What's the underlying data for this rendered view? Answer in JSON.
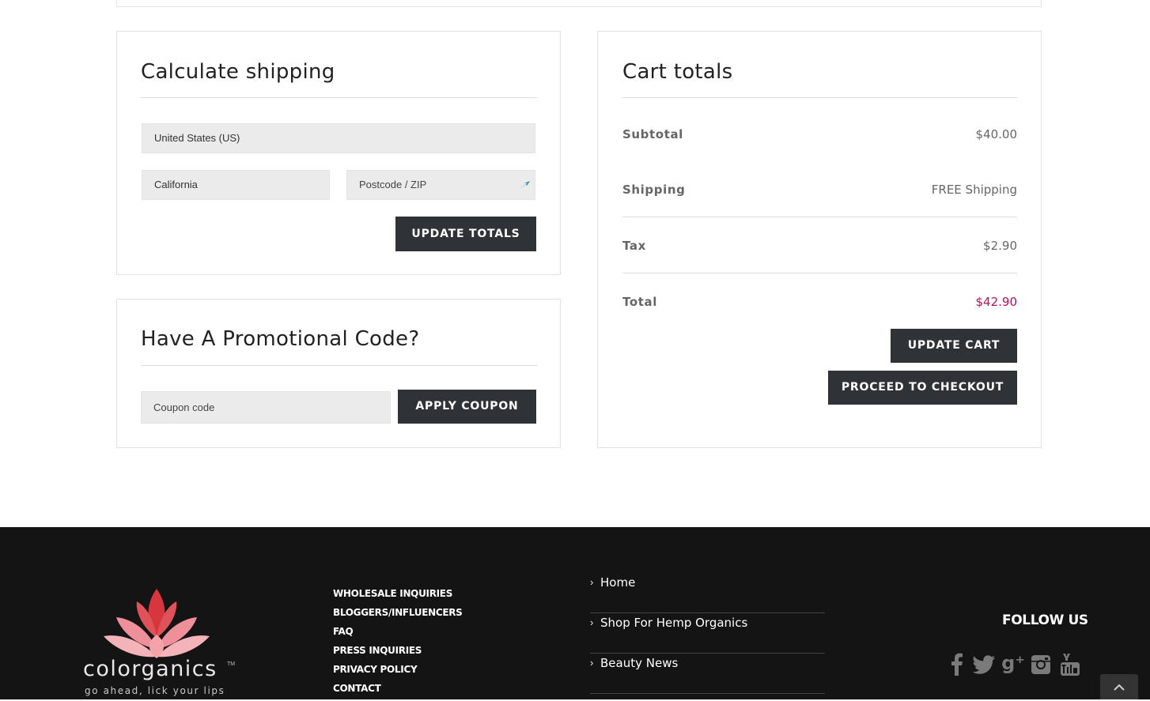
{
  "shipping": {
    "title": "Calculate shipping",
    "country": "United States (US)",
    "state": "California",
    "postcode_placeholder": "Postcode / ZIP",
    "update_totals_label": "UPDATE TOTALS"
  },
  "promo": {
    "title": "Have A Promotional Code?",
    "coupon_placeholder": "Coupon code",
    "apply_label": "APPLY COUPON"
  },
  "totals": {
    "title": "Cart totals",
    "rows": [
      {
        "label": "Subtotal",
        "value": "$40.00"
      },
      {
        "label": "Shipping",
        "value": "FREE Shipping"
      },
      {
        "label": "Tax",
        "value": "$2.90"
      },
      {
        "label": "Total",
        "value": "$42.90"
      }
    ],
    "update_cart_label": "UPDATE CART",
    "checkout_label": "PROCEED TO CHECKOUT",
    "total_color": "#b3115a"
  },
  "footer": {
    "logo": {
      "brand": "colorganics",
      "tm": "TM",
      "tagline": "go ahead, lick your lips"
    },
    "links": [
      "WHOLESALE INQUIRIES",
      "BLOGGERS/INFLUENCERS",
      "FAQ",
      "PRESS INQUIRIES",
      "PRIVACY POLICY",
      "CONTACT"
    ],
    "nav": [
      "Home",
      "Shop For Hemp Organics",
      "Beauty News"
    ],
    "follow_title": "FOLLOW US",
    "social_icons": [
      "facebook-icon",
      "twitter-icon",
      "google-plus-icon",
      "instagram-icon",
      "youtube-icon"
    ],
    "to_top_icon": "chevron-up-icon"
  }
}
